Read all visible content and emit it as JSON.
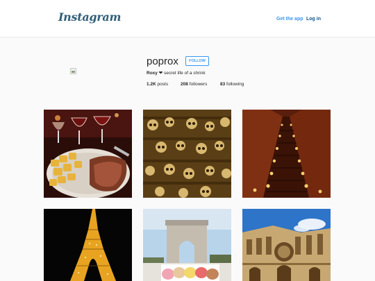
{
  "header": {
    "logo_text": "Instagram",
    "get_app_label": "Get the app",
    "login_label": "Log in"
  },
  "profile": {
    "username": "poprox",
    "follow_label": "FOLLOW",
    "full_name": "Roxy",
    "bio_heart": "❤",
    "bio_text": "secret life of a shrink",
    "posts_count": "1.2K",
    "posts_label": "posts",
    "followers_count": "208",
    "followers_label": "followers",
    "following_count": "83",
    "following_label": "following"
  },
  "colors": {
    "link_blue": "#3897f0",
    "login_blue": "#125688",
    "background": "#fafafa"
  }
}
